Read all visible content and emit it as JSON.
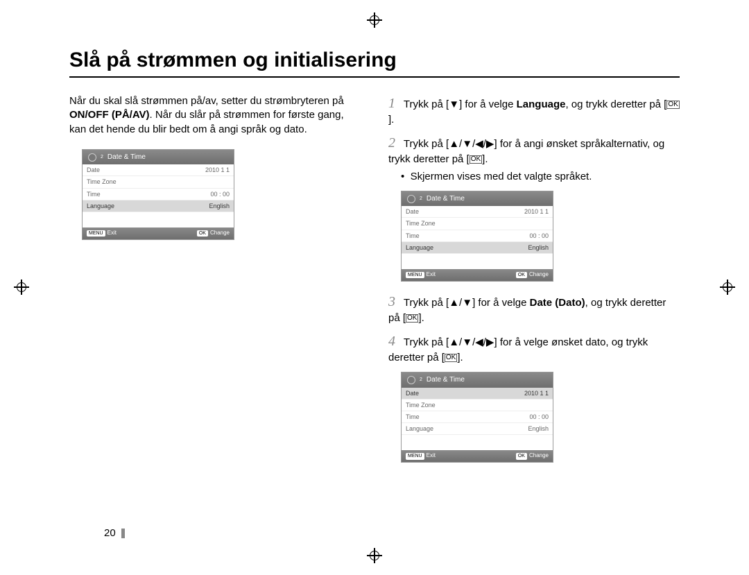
{
  "page": {
    "title": "Slå på strømmen og initialisering",
    "number": "20"
  },
  "left": {
    "intro_a": "Når du skal slå strømmen på/av, setter du strømbryteren på ",
    "intro_b_strong": "ON/OFF (PÅ/AV)",
    "intro_c": ". Når du slår på strømmen for første gang, kan det hende du blir bedt om å angi språk og dato."
  },
  "right": {
    "step1_a": "Trykk på [",
    "step1_arrow": "▼",
    "step1_b": "] for å velge ",
    "step1_strong": "Language",
    "step1_c": ", og trykk deretter på [",
    "step1_d": "].",
    "step2_a": "Trykk på [",
    "step2_arrows": "▲/▼/◀/▶",
    "step2_b": "] for å angi ønsket språkalternativ, og trykk deretter på [",
    "step2_c": "].",
    "step2_bullet": "Skjermen vises med det valgte språket.",
    "step3_a": "Trykk på [",
    "step3_arrows": "▲/▼",
    "step3_b": "] for å velge ",
    "step3_strong": "Date (Dato)",
    "step3_c": ", og trykk deretter på [",
    "step3_d": "].",
    "step4_a": "Trykk på [",
    "step4_arrows": "▲/▼/◀/▶",
    "step4_b": "] for å velge ønsket dato, og trykk deretter på [",
    "step4_c": "]."
  },
  "menu": {
    "header_title": "Date & Time",
    "gear_num": "2",
    "rows": {
      "date_label": "Date",
      "date_value": "2010   1   1",
      "tz_label": "Time Zone",
      "tz_value": "",
      "time_label": "Time",
      "time_value": "00 : 00",
      "lang_label": "Language",
      "lang_value": "English"
    },
    "footer": {
      "menu_pill": "MENU",
      "exit": "Exit",
      "ok_pill": "OK",
      "change": "Change"
    }
  },
  "icons": {
    "ok_glyph": "OK"
  }
}
